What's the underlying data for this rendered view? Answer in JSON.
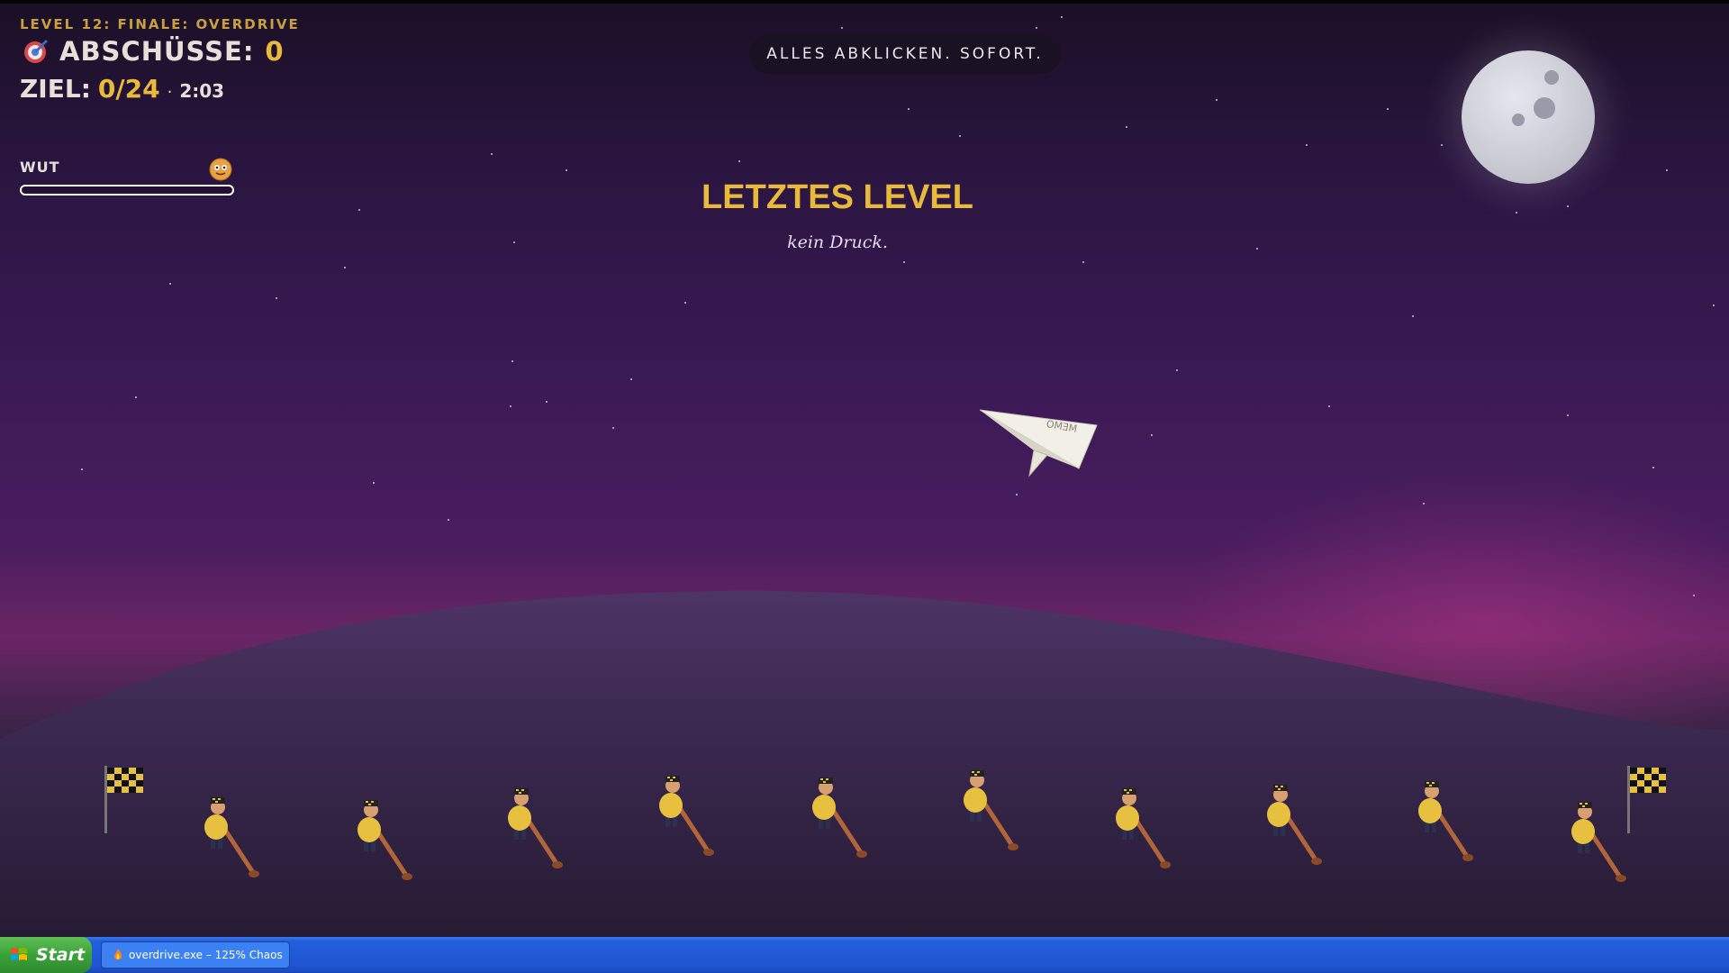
{
  "hud": {
    "level_title": "LEVEL 12: FINALE: OVERDRIVE",
    "shots_label": "ABSCHÜSSE:",
    "shots_value": "0",
    "goal_label": "ZIEL:",
    "goal_value": "0/24",
    "goal_separator": "·",
    "time": "2:03",
    "rage_label": "WUT",
    "rage_level": 0
  },
  "banner": {
    "text": "ALLES ABKLICKEN. SOFORT."
  },
  "center": {
    "title": "LETZTES LEVEL",
    "subtitle": "kein Druck."
  },
  "plane": {
    "text": "MEMO"
  },
  "scene": {
    "moon": true,
    "flags": [
      "checkered-flag-icon",
      "checkered-flag-icon"
    ],
    "enemies": [
      "person",
      "person",
      "person",
      "person",
      "person",
      "person",
      "person",
      "person",
      "person",
      "person"
    ]
  },
  "taskbar": {
    "start_label": "Start",
    "task_label": "overdrive.exe – 125% Chaos"
  },
  "colors": {
    "accent_gold": "#e8b93a",
    "sky_top": "#1b1026",
    "sky_mid": "#4a1d5e",
    "taskbar_blue": "#245fdc"
  }
}
